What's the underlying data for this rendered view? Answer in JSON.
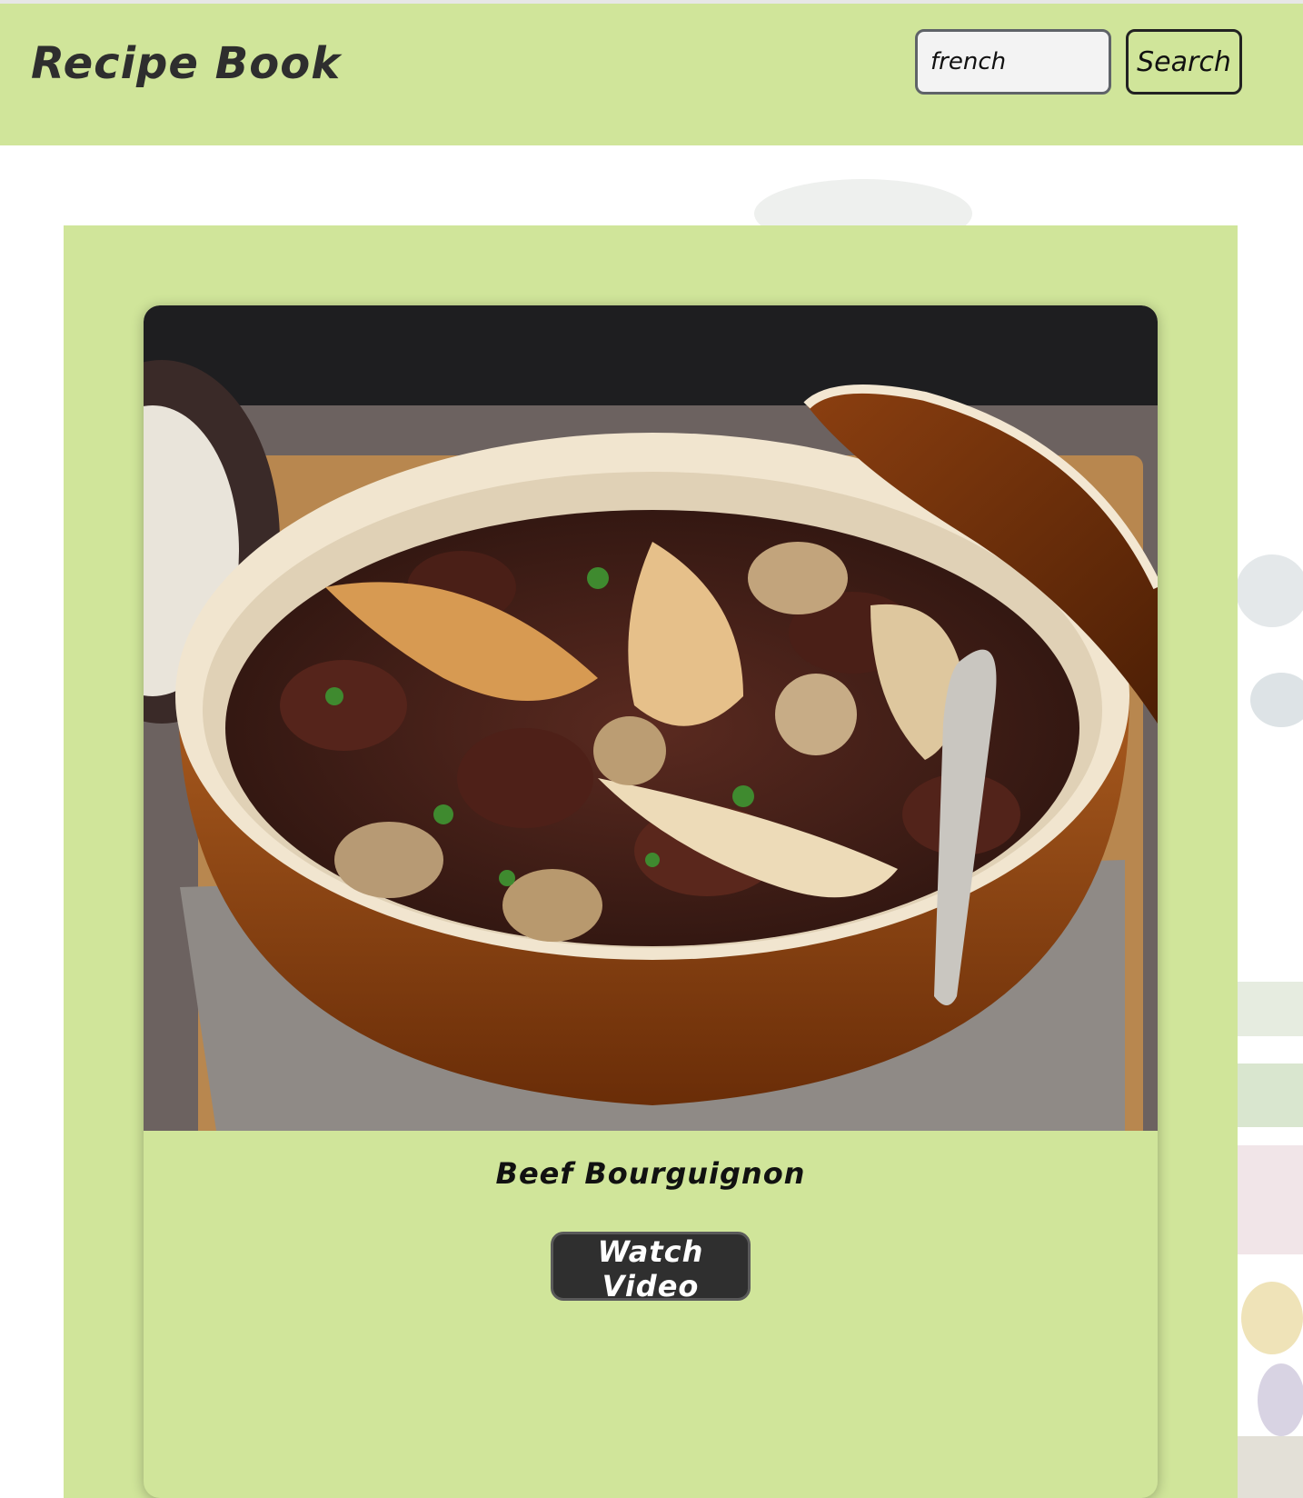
{
  "header": {
    "brand": "Recipe Book",
    "search_value": "french",
    "search_button_label": "Search"
  },
  "recipe": {
    "title": "Beef Bourguignon",
    "watch_button_label": "Watch Video",
    "image_description_icon": "beef-stew-photo"
  },
  "colors": {
    "header_bg": "#d0e59a",
    "panel_bg": "#d0e59a",
    "button_dark": "#2f2f2f",
    "text_dark": "#2e2e2e"
  }
}
